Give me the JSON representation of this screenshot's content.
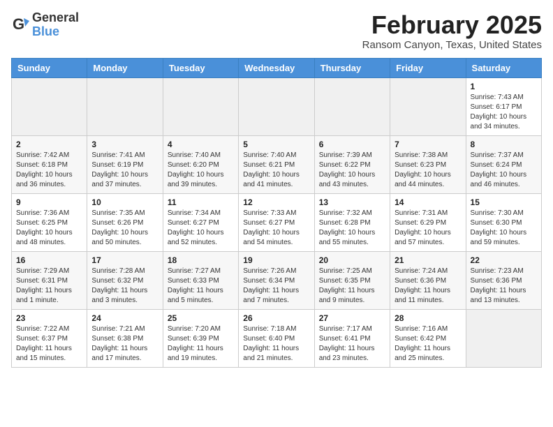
{
  "header": {
    "logo_line1": "General",
    "logo_line2": "Blue",
    "month_title": "February 2025",
    "location": "Ransom Canyon, Texas, United States"
  },
  "days_of_week": [
    "Sunday",
    "Monday",
    "Tuesday",
    "Wednesday",
    "Thursday",
    "Friday",
    "Saturday"
  ],
  "weeks": [
    [
      {
        "num": "",
        "info": ""
      },
      {
        "num": "",
        "info": ""
      },
      {
        "num": "",
        "info": ""
      },
      {
        "num": "",
        "info": ""
      },
      {
        "num": "",
        "info": ""
      },
      {
        "num": "",
        "info": ""
      },
      {
        "num": "1",
        "info": "Sunrise: 7:43 AM\nSunset: 6:17 PM\nDaylight: 10 hours and 34 minutes."
      }
    ],
    [
      {
        "num": "2",
        "info": "Sunrise: 7:42 AM\nSunset: 6:18 PM\nDaylight: 10 hours and 36 minutes."
      },
      {
        "num": "3",
        "info": "Sunrise: 7:41 AM\nSunset: 6:19 PM\nDaylight: 10 hours and 37 minutes."
      },
      {
        "num": "4",
        "info": "Sunrise: 7:40 AM\nSunset: 6:20 PM\nDaylight: 10 hours and 39 minutes."
      },
      {
        "num": "5",
        "info": "Sunrise: 7:40 AM\nSunset: 6:21 PM\nDaylight: 10 hours and 41 minutes."
      },
      {
        "num": "6",
        "info": "Sunrise: 7:39 AM\nSunset: 6:22 PM\nDaylight: 10 hours and 43 minutes."
      },
      {
        "num": "7",
        "info": "Sunrise: 7:38 AM\nSunset: 6:23 PM\nDaylight: 10 hours and 44 minutes."
      },
      {
        "num": "8",
        "info": "Sunrise: 7:37 AM\nSunset: 6:24 PM\nDaylight: 10 hours and 46 minutes."
      }
    ],
    [
      {
        "num": "9",
        "info": "Sunrise: 7:36 AM\nSunset: 6:25 PM\nDaylight: 10 hours and 48 minutes."
      },
      {
        "num": "10",
        "info": "Sunrise: 7:35 AM\nSunset: 6:26 PM\nDaylight: 10 hours and 50 minutes."
      },
      {
        "num": "11",
        "info": "Sunrise: 7:34 AM\nSunset: 6:27 PM\nDaylight: 10 hours and 52 minutes."
      },
      {
        "num": "12",
        "info": "Sunrise: 7:33 AM\nSunset: 6:27 PM\nDaylight: 10 hours and 54 minutes."
      },
      {
        "num": "13",
        "info": "Sunrise: 7:32 AM\nSunset: 6:28 PM\nDaylight: 10 hours and 55 minutes."
      },
      {
        "num": "14",
        "info": "Sunrise: 7:31 AM\nSunset: 6:29 PM\nDaylight: 10 hours and 57 minutes."
      },
      {
        "num": "15",
        "info": "Sunrise: 7:30 AM\nSunset: 6:30 PM\nDaylight: 10 hours and 59 minutes."
      }
    ],
    [
      {
        "num": "16",
        "info": "Sunrise: 7:29 AM\nSunset: 6:31 PM\nDaylight: 11 hours and 1 minute."
      },
      {
        "num": "17",
        "info": "Sunrise: 7:28 AM\nSunset: 6:32 PM\nDaylight: 11 hours and 3 minutes."
      },
      {
        "num": "18",
        "info": "Sunrise: 7:27 AM\nSunset: 6:33 PM\nDaylight: 11 hours and 5 minutes."
      },
      {
        "num": "19",
        "info": "Sunrise: 7:26 AM\nSunset: 6:34 PM\nDaylight: 11 hours and 7 minutes."
      },
      {
        "num": "20",
        "info": "Sunrise: 7:25 AM\nSunset: 6:35 PM\nDaylight: 11 hours and 9 minutes."
      },
      {
        "num": "21",
        "info": "Sunrise: 7:24 AM\nSunset: 6:36 PM\nDaylight: 11 hours and 11 minutes."
      },
      {
        "num": "22",
        "info": "Sunrise: 7:23 AM\nSunset: 6:36 PM\nDaylight: 11 hours and 13 minutes."
      }
    ],
    [
      {
        "num": "23",
        "info": "Sunrise: 7:22 AM\nSunset: 6:37 PM\nDaylight: 11 hours and 15 minutes."
      },
      {
        "num": "24",
        "info": "Sunrise: 7:21 AM\nSunset: 6:38 PM\nDaylight: 11 hours and 17 minutes."
      },
      {
        "num": "25",
        "info": "Sunrise: 7:20 AM\nSunset: 6:39 PM\nDaylight: 11 hours and 19 minutes."
      },
      {
        "num": "26",
        "info": "Sunrise: 7:18 AM\nSunset: 6:40 PM\nDaylight: 11 hours and 21 minutes."
      },
      {
        "num": "27",
        "info": "Sunrise: 7:17 AM\nSunset: 6:41 PM\nDaylight: 11 hours and 23 minutes."
      },
      {
        "num": "28",
        "info": "Sunrise: 7:16 AM\nSunset: 6:42 PM\nDaylight: 11 hours and 25 minutes."
      },
      {
        "num": "",
        "info": ""
      }
    ]
  ]
}
